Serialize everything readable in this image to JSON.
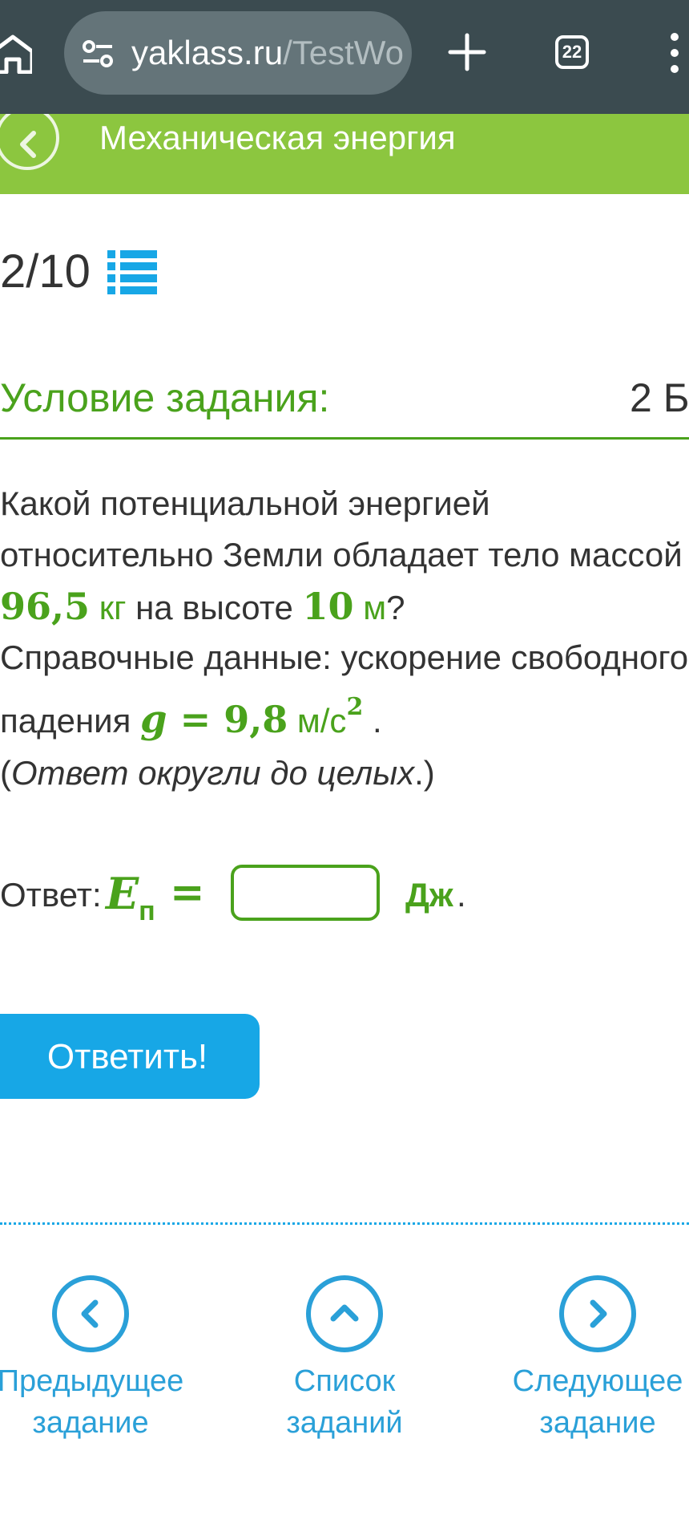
{
  "browser": {
    "url_domain": "yaklass.ru",
    "url_path": "/TestWo",
    "tab_count": "22",
    "icons": [
      "home-icon",
      "tune-icon",
      "plus-icon",
      "tabs-icon",
      "more-vert-icon"
    ]
  },
  "header": {
    "title": "Механическая энергия"
  },
  "progress": {
    "text": "2/10"
  },
  "condition": {
    "title": "Условие задания:",
    "points": "2 Б."
  },
  "task": {
    "line1": "Какой потенциальной энергией",
    "line2": "относительно Земли обладает тело массой",
    "mass_value": "96,5",
    "mass_unit": "кг",
    "mid_text": " на высоте ",
    "height_value": "10",
    "height_unit": "м",
    "q_mark": "?",
    "line4": "Справочные данные: ускорение свободного",
    "line5_prefix": "падения ",
    "g_symbol": "g",
    "equals": " = ",
    "g_value": "9,8",
    "g_unit": "м/с",
    "g_power": "2",
    "period": ".",
    "note_open": "(",
    "note_text": "Ответ округли до целых",
    "note_close": ".)"
  },
  "answer": {
    "label": "Ответ:",
    "var_symbol": "E",
    "var_sub": "п",
    "equals": "=",
    "input_value": "",
    "unit": "Дж",
    "dot": "."
  },
  "submit": {
    "label": "Ответить!"
  },
  "nav": {
    "prev_line1": "Предыдущее",
    "prev_line2": "задание",
    "list_line1": "Список",
    "list_line2": "заданий",
    "next_line1": "Следующее",
    "next_line2": "задание"
  },
  "colors": {
    "green": "#8cc63f",
    "dark_green": "#4aa21c",
    "blue": "#17a7e6",
    "browser_bar": "#3b4b50"
  }
}
